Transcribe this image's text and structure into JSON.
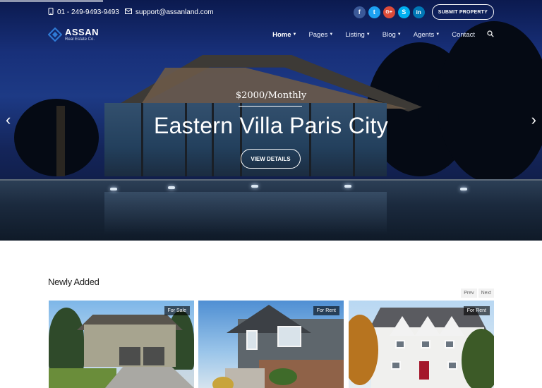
{
  "topbar": {
    "phone": "01 - 249-9493-9493",
    "email": "support@assanland.com",
    "socials": [
      {
        "icon": "facebook-icon",
        "glyph": "f",
        "color": "#3b5998"
      },
      {
        "icon": "twitter-icon",
        "glyph": "t",
        "color": "#1da1f2"
      },
      {
        "icon": "google-plus-icon",
        "glyph": "G+",
        "color": "#dd4b39"
      },
      {
        "icon": "skype-icon",
        "glyph": "S",
        "color": "#00aff0"
      },
      {
        "icon": "linkedin-icon",
        "glyph": "in",
        "color": "#0077b5"
      }
    ],
    "submit_label": "SUBMIT PROPERTY"
  },
  "nav": {
    "logo_name": "ASSAN",
    "logo_sub": "Real Estate Co.",
    "items": [
      {
        "label": "Home",
        "dropdown": true
      },
      {
        "label": "Pages",
        "dropdown": true
      },
      {
        "label": "Listing",
        "dropdown": true
      },
      {
        "label": "Blog",
        "dropdown": true
      },
      {
        "label": "Agents",
        "dropdown": true
      },
      {
        "label": "Contact",
        "dropdown": false
      }
    ],
    "search_icon": "search-icon"
  },
  "hero": {
    "price": "$2000/Monthly",
    "title": "Eastern Villa Paris City",
    "button": "VIEW DETAILS",
    "prev_arrow": "‹",
    "next_arrow": "›"
  },
  "section": {
    "title": "Newly Added",
    "prev": "Prev",
    "next": "Next"
  },
  "cards": [
    {
      "badge": "For Sale"
    },
    {
      "badge": "For Rent"
    },
    {
      "badge": "For Rent"
    }
  ],
  "colors": {
    "accent": "#2f7bd6",
    "hero_dark": "#0b1a4f"
  }
}
